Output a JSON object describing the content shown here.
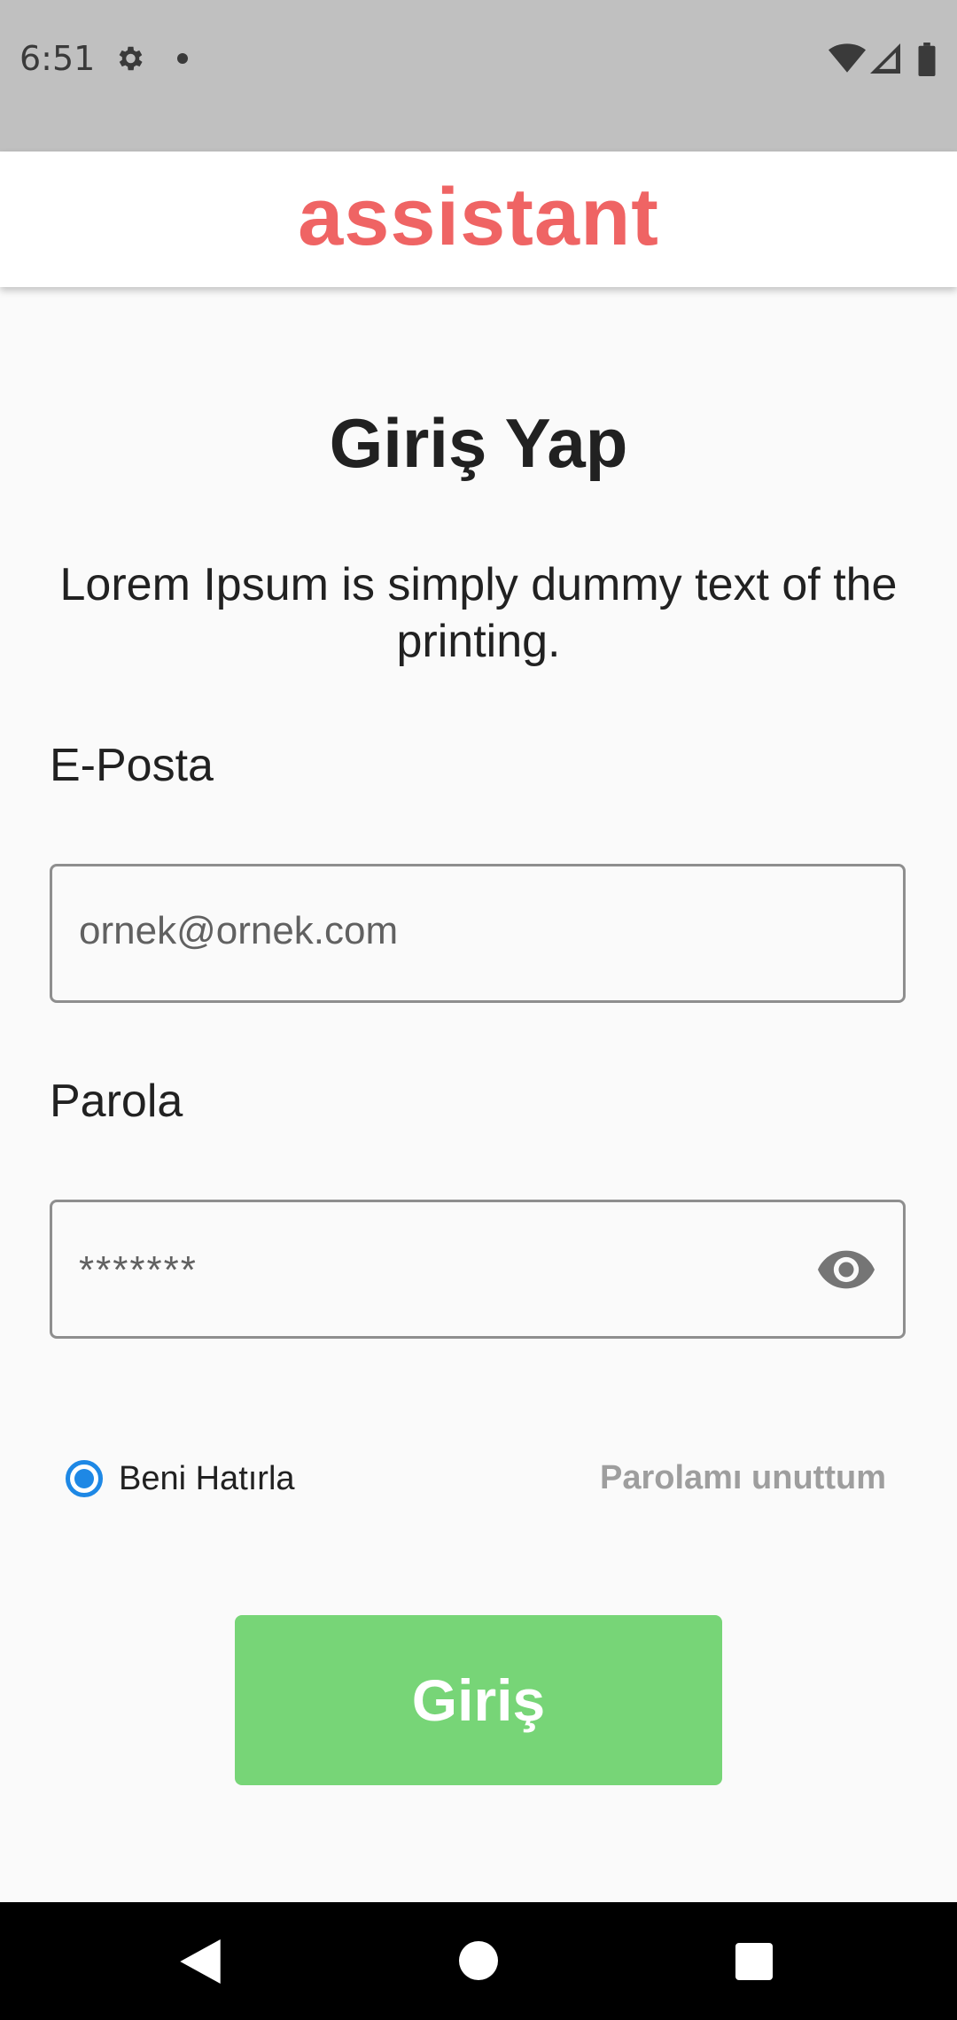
{
  "status_bar": {
    "time": "6:51",
    "icons": [
      "settings-gear-icon",
      "notification-dot-icon",
      "wifi-icon",
      "cellular-signal-icon",
      "battery-icon"
    ]
  },
  "app_bar": {
    "title": "assistant",
    "title_color": "#ef6464"
  },
  "login": {
    "heading": "Giriş Yap",
    "subtitle": "Lorem Ipsum is simply dummy text of the printing.",
    "email": {
      "label": "E-Posta",
      "placeholder": "ornek@ornek.com"
    },
    "password": {
      "label": "Parola",
      "placeholder": "*******",
      "toggle_icon": "eye-icon"
    },
    "remember_me": {
      "label": "Beni Hatırla",
      "checked": true,
      "accent_color": "#1e88e5"
    },
    "forgot_password": "Parolamı unuttum",
    "submit_label": "Giriş",
    "submit_color": "#77d577"
  },
  "nav_bar": {
    "buttons": [
      "back-icon",
      "home-icon",
      "recent-apps-icon"
    ]
  }
}
